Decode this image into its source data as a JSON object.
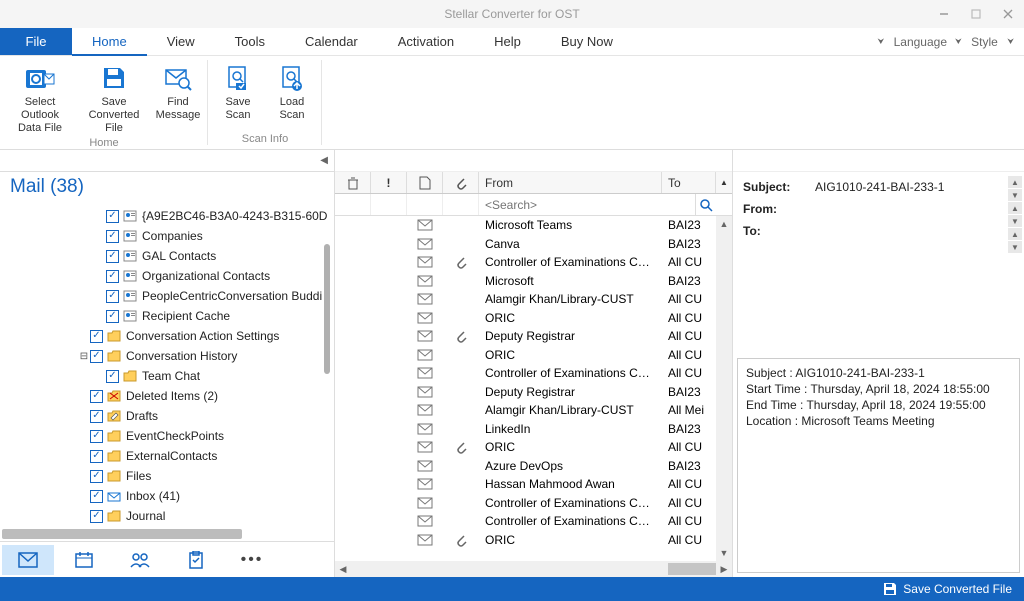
{
  "title": "Stellar Converter for OST",
  "menu": {
    "file": "File",
    "tabs": [
      "Home",
      "View",
      "Tools",
      "Calendar",
      "Activation",
      "Help",
      "Buy Now"
    ],
    "active": "Home",
    "language": "Language",
    "style": "Style"
  },
  "ribbon": {
    "group_home": "Home",
    "group_scan": "Scan Info",
    "select_outlook": "Select Outlook\nData File",
    "save_converted": "Save\nConverted File",
    "find_message": "Find\nMessage",
    "save_scan": "Save\nScan",
    "load_scan": "Load\nScan"
  },
  "mail_header": "Mail (38)",
  "tree": [
    {
      "pad": "pad4",
      "tw": "",
      "checked": true,
      "icon": "contacts",
      "label": "{A9E2BC46-B3A0-4243-B315-60D"
    },
    {
      "pad": "pad4",
      "tw": "",
      "checked": true,
      "icon": "contacts",
      "label": "Companies"
    },
    {
      "pad": "pad4",
      "tw": "",
      "checked": true,
      "icon": "contacts",
      "label": "GAL Contacts"
    },
    {
      "pad": "pad4",
      "tw": "",
      "checked": true,
      "icon": "contacts",
      "label": "Organizational Contacts"
    },
    {
      "pad": "pad4",
      "tw": "",
      "checked": true,
      "icon": "contacts",
      "label": "PeopleCentricConversation Buddi"
    },
    {
      "pad": "pad4",
      "tw": "",
      "checked": true,
      "icon": "contacts",
      "label": "Recipient Cache"
    },
    {
      "pad": "pad3",
      "tw": "",
      "checked": true,
      "icon": "folder",
      "label": "Conversation Action Settings"
    },
    {
      "pad": "pad3",
      "tw": "−",
      "checked": true,
      "icon": "folder",
      "label": "Conversation History"
    },
    {
      "pad": "pad4",
      "tw": "",
      "checked": true,
      "icon": "folder",
      "label": "Team Chat"
    },
    {
      "pad": "pad3",
      "tw": "",
      "checked": true,
      "icon": "folder-del",
      "label": "Deleted Items (2)"
    },
    {
      "pad": "pad3",
      "tw": "",
      "checked": true,
      "icon": "folder-draft",
      "label": "Drafts"
    },
    {
      "pad": "pad3",
      "tw": "",
      "checked": true,
      "icon": "folder",
      "label": "EventCheckPoints"
    },
    {
      "pad": "pad3",
      "tw": "",
      "checked": true,
      "icon": "folder",
      "label": "ExternalContacts"
    },
    {
      "pad": "pad3",
      "tw": "",
      "checked": true,
      "icon": "folder",
      "label": "Files"
    },
    {
      "pad": "pad3",
      "tw": "",
      "checked": true,
      "icon": "inbox",
      "label": "Inbox (41)"
    },
    {
      "pad": "pad3",
      "tw": "",
      "checked": true,
      "icon": "folder",
      "label": "Journal"
    }
  ],
  "list": {
    "col_from": "From",
    "col_to": "To",
    "search_placeholder": "<Search>",
    "rows": [
      {
        "att": false,
        "from": "Microsoft Teams",
        "to": "BAI23"
      },
      {
        "att": false,
        "from": "Canva",
        "to": "BAI23"
      },
      {
        "att": true,
        "from": "Controller of Examinations CU...",
        "to": "All CU"
      },
      {
        "att": false,
        "from": "Microsoft",
        "to": "BAI23"
      },
      {
        "att": false,
        "from": "Alamgir Khan/Library-CUST",
        "to": "All CU"
      },
      {
        "att": false,
        "from": "ORIC",
        "to": "All CU"
      },
      {
        "att": true,
        "from": "Deputy Registrar",
        "to": "All CU"
      },
      {
        "att": false,
        "from": "ORIC",
        "to": "All CU"
      },
      {
        "att": false,
        "from": "Controller of Examinations CU...",
        "to": "All CU"
      },
      {
        "att": false,
        "from": "Deputy Registrar",
        "to": "BAI23"
      },
      {
        "att": false,
        "from": "Alamgir Khan/Library-CUST",
        "to": "All Mei"
      },
      {
        "att": false,
        "from": "LinkedIn",
        "to": "BAI23"
      },
      {
        "att": true,
        "from": "ORIC",
        "to": "All CU"
      },
      {
        "att": false,
        "from": "Azure DevOps",
        "to": "BAI23"
      },
      {
        "att": false,
        "from": "Hassan Mahmood Awan",
        "to": "All CU"
      },
      {
        "att": false,
        "from": "Controller of Examinations CU...",
        "to": "All CU"
      },
      {
        "att": false,
        "from": "Controller of Examinations CU...",
        "to": "All CU"
      },
      {
        "att": true,
        "from": "ORIC",
        "to": "All CU"
      }
    ]
  },
  "preview": {
    "subject_label": "Subject:",
    "subject_value": "AIG1010-241-BAI-233-1",
    "from_label": "From:",
    "from_value": "",
    "to_label": "To:",
    "to_value": "",
    "body_subject": "Subject : AIG1010-241-BAI-233-1",
    "body_start": "Start Time : Thursday, April 18, 2024 18:55:00",
    "body_end": "End Time : Thursday, April 18, 2024 19:55:00",
    "body_location": "Location : Microsoft Teams Meeting"
  },
  "status": {
    "save": "Save Converted File"
  }
}
